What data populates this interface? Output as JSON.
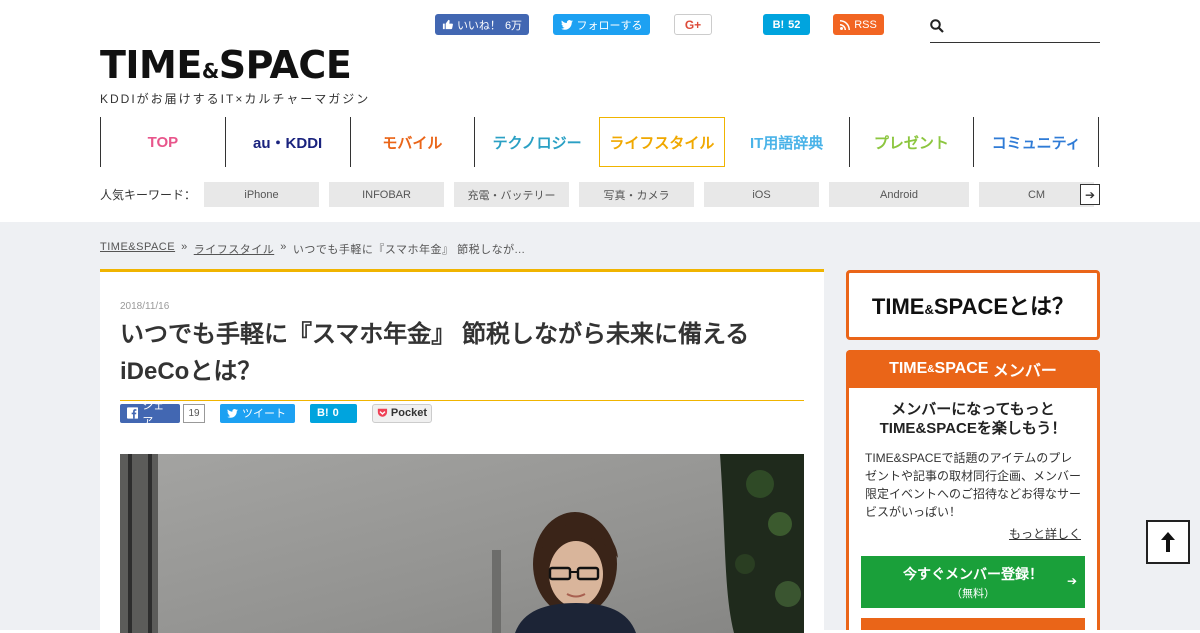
{
  "social_top": {
    "fb_like_label": "いいね！",
    "fb_like_count": "6万",
    "tw_follow_label": "フォローする",
    "gplus_label": "G+",
    "hatena_label": "B!",
    "hatena_count": "52",
    "rss_label": "RSS"
  },
  "search": {
    "placeholder": ""
  },
  "logo": {
    "main_a": "TIME",
    "amp": "&",
    "main_b": "SPACE",
    "sub": "KDDIがお届けするIT×カルチャーマガジン"
  },
  "nav": {
    "items": [
      {
        "label": "TOP",
        "color": "#e8558b"
      },
      {
        "label": "au・KDDI",
        "color": "#1a237e"
      },
      {
        "label": "モバイル",
        "color": "#ea6518"
      },
      {
        "label": "テクノロジー",
        "color": "#2aa0c4"
      },
      {
        "label": "ライフスタイル",
        "color": "#f0a800"
      },
      {
        "label": "IT用語辞典",
        "color": "#4ab3e8"
      },
      {
        "label": "プレゼント",
        "color": "#8cc63f"
      },
      {
        "label": "コミュニティ",
        "color": "#2f7bd6"
      }
    ]
  },
  "keywords": {
    "label": "人気キーワード：",
    "tags": [
      "iPhone",
      "INFOBAR",
      "充電・バッテリー",
      "写真・カメラ",
      "iOS",
      "Android",
      "CM"
    ],
    "more_icon": "arrow-right-icon"
  },
  "breadcrumb": {
    "home": "TIME&SPACE",
    "sep": "»",
    "category": "ライフスタイル",
    "current": "いつでも手軽に『スマホ年金』 節税しなが..."
  },
  "article": {
    "date": "2018/11/16",
    "title": "いつでも手軽に『スマホ年金』 節税しながら未来に備えるiDeCoとは？",
    "share": {
      "fb_label": "シェア",
      "fb_count": "19",
      "tw_label": "ツイート",
      "hb_label": "B!",
      "hb_count": "0",
      "pocket_label": "Pocket"
    }
  },
  "sidebar": {
    "about_a": "TIME",
    "about_amp": "&",
    "about_b": "SPACE",
    "about_suffix": "とは？",
    "member_head_a": "TIME",
    "member_head_amp": "&",
    "member_head_b": "SPACE",
    "member_head_suffix": "メンバー",
    "tagline_1": "メンバーになってもっと",
    "tagline_2": "TIME&SPACEを楽しもう！",
    "text": "TIME&SPACEで話題のアイテムのプレゼントや記事の取材同行企画、メンバー限定イベントへのご招待などお得なサービスがいっぱい！",
    "more": "もっと詳しく",
    "register_label": "今すぐメンバー登録！",
    "register_sub": "（無料）"
  },
  "colors": {
    "accent_orange": "#ea6518",
    "accent_yellow": "#f0b400",
    "register_green": "#1aa03a"
  }
}
